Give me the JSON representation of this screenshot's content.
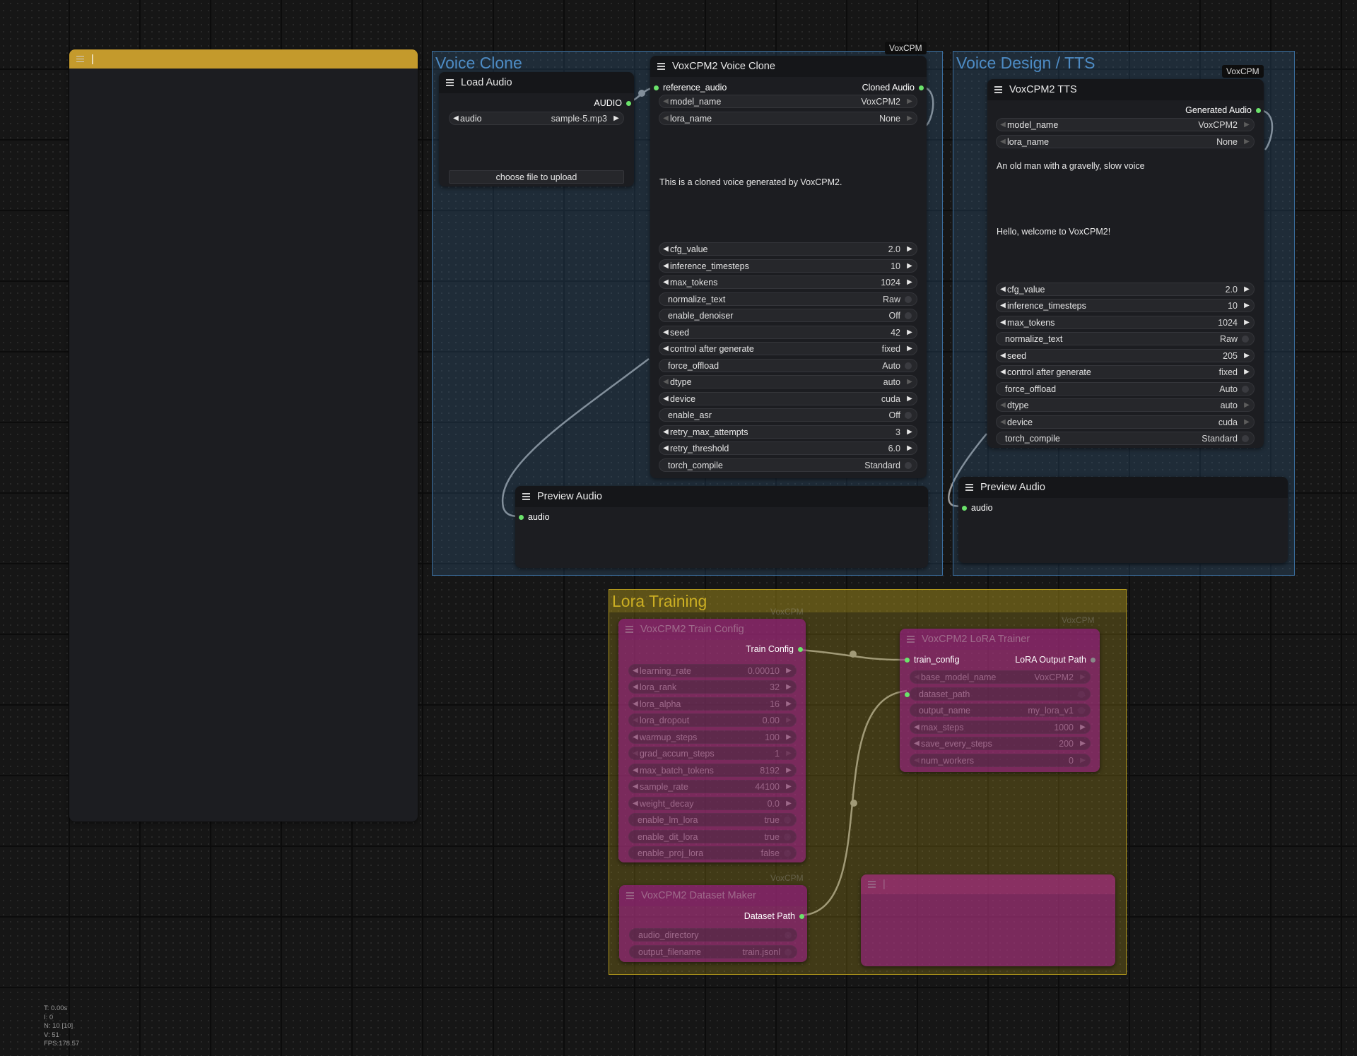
{
  "groups": {
    "voice_clone": {
      "title": "Voice Clone",
      "color": "#3b6fa0"
    },
    "voice_design": {
      "title": "Voice Design / TTS",
      "color": "#3b6fa0"
    },
    "lora_training": {
      "title": "Lora Training",
      "color": "#b59b1c"
    }
  },
  "badges": {
    "vc": "VoxCPM",
    "tts": "VoxCPM",
    "train": "VoxCPM",
    "trainer": "VoxCPM",
    "dataset": "VoxCPM"
  },
  "note_node": {
    "title": "|"
  },
  "note_node2": {
    "title": "|"
  },
  "load_audio": {
    "title": "Load Audio",
    "output": "AUDIO",
    "audio_label": "audio",
    "audio_value": "sample-5.mp3",
    "upload_button": "choose file to upload"
  },
  "voice_clone_node": {
    "title": "VoxCPM2 Voice Clone",
    "input": "reference_audio",
    "output": "Cloned Audio",
    "text": "This is a cloned voice generated by VoxCPM2.",
    "widgets": [
      {
        "label": "model_name",
        "value": "VoxCPM2"
      },
      {
        "label": "lora_name",
        "value": "None"
      },
      {
        "label": "cfg_value",
        "value": "2.0"
      },
      {
        "label": "inference_timesteps",
        "value": "10"
      },
      {
        "label": "max_tokens",
        "value": "1024"
      },
      {
        "label": "normalize_text",
        "value": "Raw"
      },
      {
        "label": "enable_denoiser",
        "value": "Off"
      },
      {
        "label": "seed",
        "value": "42"
      },
      {
        "label": "control after generate",
        "value": "fixed"
      },
      {
        "label": "force_offload",
        "value": "Auto"
      },
      {
        "label": "dtype",
        "value": "auto"
      },
      {
        "label": "device",
        "value": "cuda"
      },
      {
        "label": "enable_asr",
        "value": "Off"
      },
      {
        "label": "retry_max_attempts",
        "value": "3"
      },
      {
        "label": "retry_threshold",
        "value": "6.0"
      },
      {
        "label": "torch_compile",
        "value": "Standard"
      }
    ]
  },
  "preview_audio_1": {
    "title": "Preview Audio",
    "input": "audio"
  },
  "tts_node": {
    "title": "VoxCPM2 TTS",
    "output": "Generated Audio",
    "control_instruction": "An old man with a gravelly, slow voice",
    "text": "Hello, welcome to VoxCPM2!",
    "widgets": [
      {
        "label": "model_name",
        "value": "VoxCPM2"
      },
      {
        "label": "lora_name",
        "value": "None"
      },
      {
        "label": "cfg_value",
        "value": "2.0"
      },
      {
        "label": "inference_timesteps",
        "value": "10"
      },
      {
        "label": "max_tokens",
        "value": "1024"
      },
      {
        "label": "normalize_text",
        "value": "Raw"
      },
      {
        "label": "seed",
        "value": "205"
      },
      {
        "label": "control after generate",
        "value": "fixed"
      },
      {
        "label": "force_offload",
        "value": "Auto"
      },
      {
        "label": "dtype",
        "value": "auto"
      },
      {
        "label": "device",
        "value": "cuda"
      },
      {
        "label": "torch_compile",
        "value": "Standard"
      }
    ]
  },
  "preview_audio_2": {
    "title": "Preview Audio",
    "input": "audio"
  },
  "train_config": {
    "title": "VoxCPM2 Train Config",
    "output": "Train Config",
    "widgets": [
      {
        "label": "learning_rate",
        "value": "0.00010"
      },
      {
        "label": "lora_rank",
        "value": "32"
      },
      {
        "label": "lora_alpha",
        "value": "16"
      },
      {
        "label": "lora_dropout",
        "value": "0.00"
      },
      {
        "label": "warmup_steps",
        "value": "100"
      },
      {
        "label": "grad_accum_steps",
        "value": "1"
      },
      {
        "label": "max_batch_tokens",
        "value": "8192"
      },
      {
        "label": "sample_rate",
        "value": "44100"
      },
      {
        "label": "weight_decay",
        "value": "0.0"
      },
      {
        "label": "enable_lm_lora",
        "value": "true"
      },
      {
        "label": "enable_dit_lora",
        "value": "true"
      },
      {
        "label": "enable_proj_lora",
        "value": "false"
      }
    ]
  },
  "lora_trainer": {
    "title": "VoxCPM2 LoRA Trainer",
    "input": "train_config",
    "output": "LoRA Output Path",
    "widgets": [
      {
        "label": "base_model_name",
        "value": "VoxCPM2"
      },
      {
        "label": "dataset_path",
        "value": ""
      },
      {
        "label": "output_name",
        "value": "my_lora_v1"
      },
      {
        "label": "max_steps",
        "value": "1000"
      },
      {
        "label": "save_every_steps",
        "value": "200"
      },
      {
        "label": "num_workers",
        "value": "0"
      }
    ]
  },
  "dataset_maker": {
    "title": "VoxCPM2 Dataset Maker",
    "output": "Dataset Path",
    "widgets": [
      {
        "label": "audio_directory",
        "value": ""
      },
      {
        "label": "output_filename",
        "value": "train.jsonl"
      }
    ]
  },
  "stats": {
    "t": "T: 0.00s",
    "i": "I: 0",
    "n": "N: 10 [10]",
    "v": "V: 51",
    "fps": "FPS:178.57"
  }
}
